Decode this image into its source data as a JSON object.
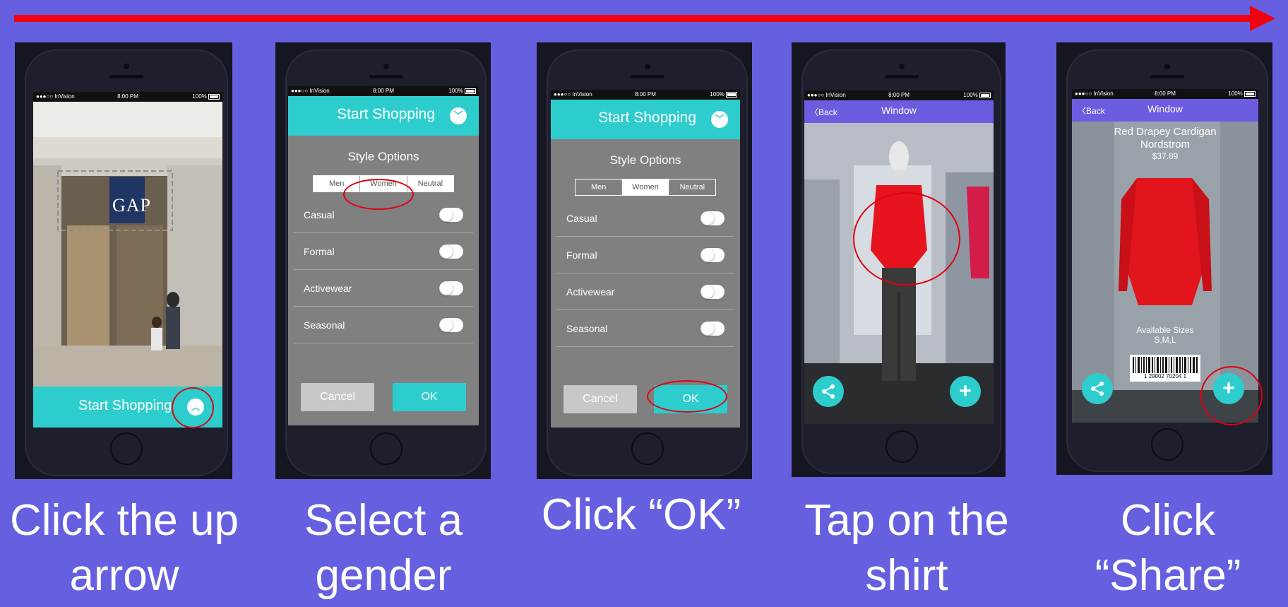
{
  "status_bar": {
    "carrier": "●●●○○ InVision",
    "time": "8:00 PM",
    "battery": "100%"
  },
  "colors": {
    "background": "#6660e0",
    "arrow": "#f00010",
    "teal": "#2ecdcd",
    "nav_purple": "#6c5ce0",
    "highlight_ring": "#e00010"
  },
  "step1": {
    "caption_line1": "Click the up",
    "caption_line2": "arrow",
    "store_sign": "GAP",
    "footer_label": "Start Shopping",
    "toggle_icon": "chevron-up-icon"
  },
  "step2": {
    "caption_line1": "Select a",
    "caption_line2": "gender",
    "header_title": "Start Shopping",
    "style_title": "Style Options",
    "genders": [
      "Men",
      "Women",
      "Neutral"
    ],
    "options": [
      "Casual",
      "Formal",
      "Activewear",
      "Seasonal"
    ],
    "cancel_label": "Cancel",
    "ok_label": "OK"
  },
  "step3": {
    "caption_line1": "Click “OK”",
    "header_title": "Start Shopping",
    "style_title": "Style Options",
    "genders": [
      "Men",
      "Women",
      "Neutral"
    ],
    "options": [
      "Casual",
      "Formal",
      "Activewear",
      "Seasonal"
    ],
    "cancel_label": "Cancel",
    "ok_label": "OK"
  },
  "step4": {
    "caption_line1": "Tap on the",
    "caption_line2": "shirt",
    "back_label": "Back",
    "nav_title": "Window"
  },
  "step5": {
    "caption_line1": "Click",
    "caption_line2": "“Share”",
    "back_label": "Back",
    "nav_title": "Window",
    "product_name": "Red Drapey Cardigan",
    "store": "Nordstrom",
    "price": "$37.89",
    "sizes_label": "Available Sizes",
    "sizes": "S,M,L",
    "barcode_number": "1 29002 70204 1"
  }
}
